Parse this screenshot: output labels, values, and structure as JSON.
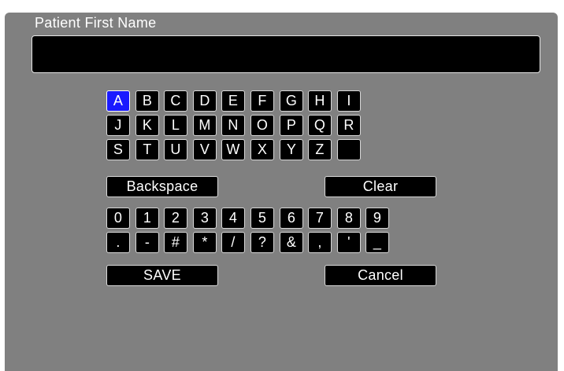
{
  "dialog": {
    "title": "Patient First Name",
    "input_value": ""
  },
  "keyboard": {
    "selected_key": "A",
    "letter_rows": [
      [
        "A",
        "B",
        "C",
        "D",
        "E",
        "F",
        "G",
        "H",
        "I"
      ],
      [
        "J",
        "K",
        "L",
        "M",
        "N",
        "O",
        "P",
        "Q",
        "R"
      ],
      [
        "S",
        "T",
        "U",
        "V",
        "W",
        "X",
        "Y",
        "Z",
        ""
      ]
    ],
    "backspace_label": "Backspace",
    "clear_label": "Clear",
    "digits": [
      "0",
      "1",
      "2",
      "3",
      "4",
      "5",
      "6",
      "7",
      "8",
      "9"
    ],
    "symbols": [
      ".",
      "-",
      "#",
      "*",
      "/",
      "?",
      "&",
      ",",
      "'",
      "_"
    ],
    "save_label": "SAVE",
    "cancel_label": "Cancel"
  },
  "colors": {
    "panel_bg": "#808080",
    "key_bg": "#000000",
    "selected_key_bg": "#1a1aff"
  }
}
